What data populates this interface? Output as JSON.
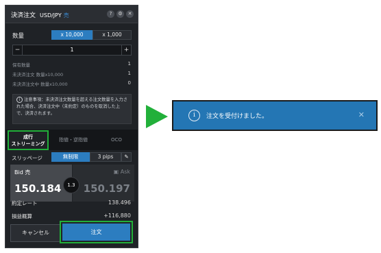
{
  "panel": {
    "title": "決済注文",
    "pair": "USD/JPY",
    "side": "売",
    "icons": {
      "help": "?",
      "settings": "⚙",
      "close": "✕"
    }
  },
  "quantity": {
    "label": "数量",
    "unit_options": [
      "x 10,000",
      "x 1,000"
    ],
    "selected_unit": "x 10,000",
    "minus": "−",
    "value": "1",
    "plus": "+"
  },
  "holdings": [
    {
      "label": "保有数量",
      "value": "1"
    },
    {
      "label": "未決済注文 数量x10,000",
      "value": "1"
    },
    {
      "label": "未決済注文中 数量x10,000",
      "value": "0"
    }
  ],
  "notice": {
    "icon": "i",
    "text": "注意事項：未決済注文数量を超える注文数量を入力された場合、決済注文中（未約定）のものを取消した上で、決済されます。"
  },
  "tabs": [
    {
      "line1": "成行",
      "line2": "ストリーミング"
    },
    {
      "label": "指値・逆指値"
    },
    {
      "label": "OCO"
    }
  ],
  "slippage": {
    "label": "スリッページ",
    "options": [
      "無制限",
      "3 pips"
    ],
    "selected": "無制限",
    "edit_icon": "✎"
  },
  "bid": {
    "label": "Bid 売",
    "price": "150.184"
  },
  "spread": "1.3",
  "ask": {
    "label": "Ask",
    "price": "150.197"
  },
  "summary": [
    {
      "label": "約定レート",
      "value": "138.496"
    },
    {
      "label": "損益概算",
      "value": "+116,880"
    }
  ],
  "buttons": {
    "cancel": "キャンセル",
    "order": "注文"
  },
  "toast": {
    "message": "注文を受付けました。",
    "icon": "i",
    "close": "✕"
  },
  "colors": {
    "accent_blue": "#2c7dc0",
    "highlight_green": "#22b03a",
    "panel_bg": "#1f2226",
    "toast_bg": "#2476b4"
  }
}
